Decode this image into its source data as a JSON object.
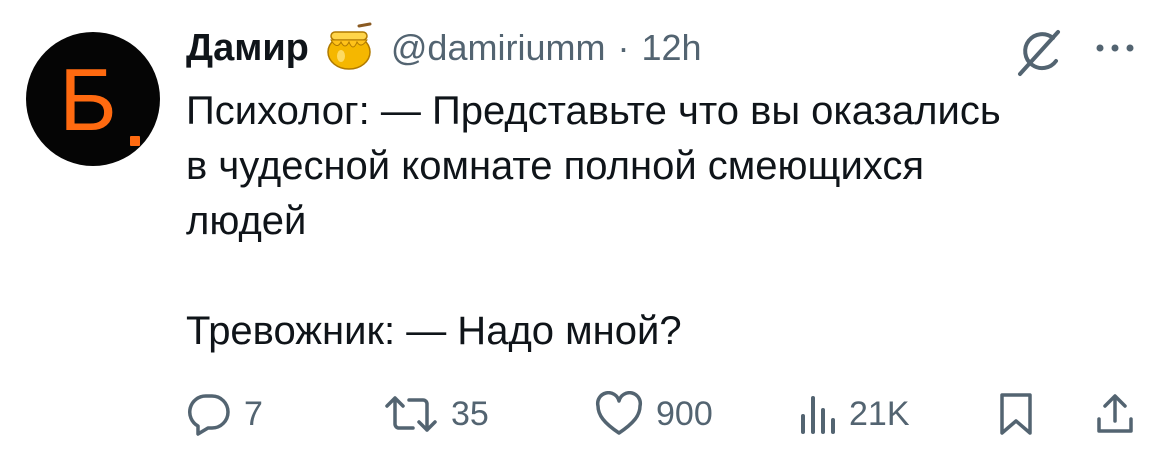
{
  "author": {
    "name": "Дамир",
    "avatar_letter": "Б",
    "badge_icon": "honey-pot-icon",
    "handle": "@damiriumm",
    "separator": "·",
    "time": "12h"
  },
  "body": {
    "lines": [
      "Психолог: — Представьте что вы оказались",
      "в чудесной комнате полной смеющихся",
      "людей",
      "Тревожник: — Надо мной?"
    ]
  },
  "actions": {
    "replies": "7",
    "retweets": "35",
    "likes": "900",
    "views": "21K"
  },
  "icons": {
    "top_right": [
      "grok-icon",
      "more-options-icon"
    ],
    "bottom": [
      "reply-icon",
      "retweet-icon",
      "like-icon",
      "views-icon",
      "bookmark-icon",
      "share-icon"
    ]
  },
  "colors": {
    "text": "#0f1419",
    "secondary": "#536471",
    "avatar_bg": "#050505",
    "avatar_letter": "#ff6a10",
    "honey": "#f5b700"
  }
}
